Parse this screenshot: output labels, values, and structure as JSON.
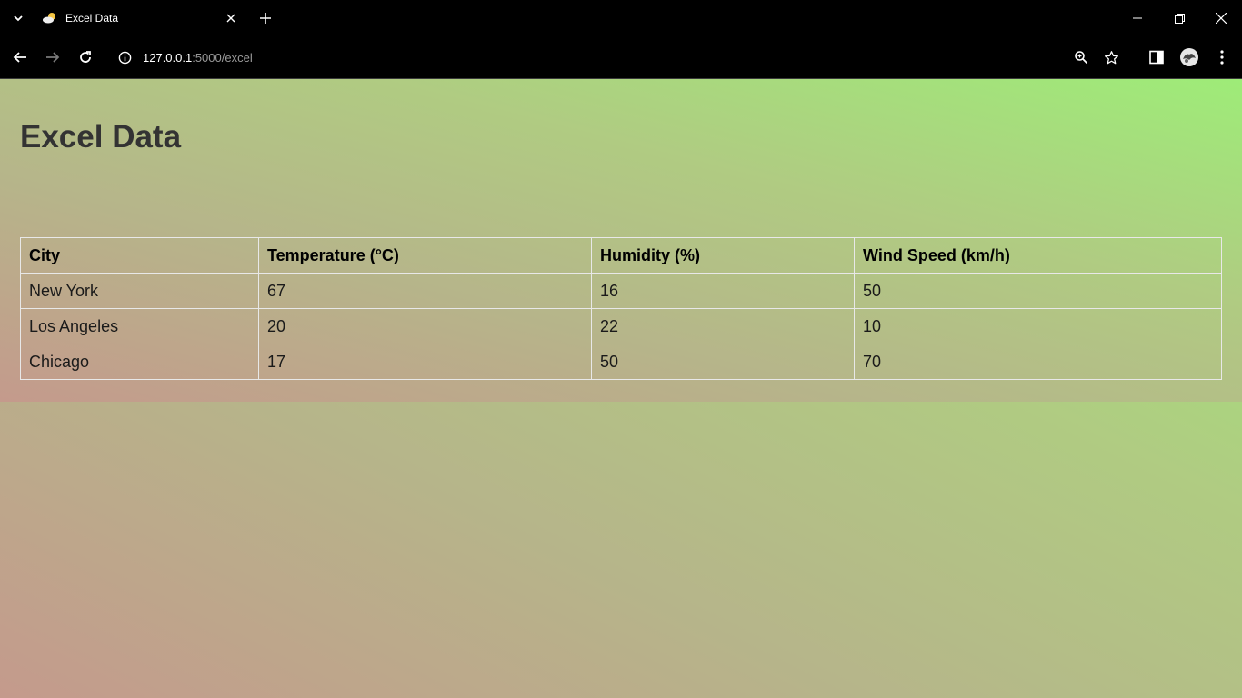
{
  "browser": {
    "tab_title": "Excel Data",
    "url_host": "127.0.0.1",
    "url_rest": ":5000/excel"
  },
  "page": {
    "title": "Excel Data",
    "table": {
      "headers": [
        "City",
        "Temperature (°C)",
        "Humidity (%)",
        "Wind Speed (km/h)"
      ],
      "rows": [
        [
          "New York",
          "67",
          "16",
          "50"
        ],
        [
          "Los Angeles",
          "20",
          "22",
          "10"
        ],
        [
          "Chicago",
          "17",
          "50",
          "70"
        ]
      ]
    }
  },
  "colors": {
    "gradient_bottom_left": "#c49a8c",
    "gradient_top_right": "#9eec78",
    "title_text": "#333333",
    "table_border": "#e8e8e8"
  },
  "icons": {
    "tab_favicon": "weather-icon",
    "tab_dropdown": "chevron-down-icon",
    "tab_close": "close-icon",
    "new_tab": "plus-icon",
    "back": "back-arrow-icon",
    "forward": "forward-arrow-icon",
    "reload": "reload-icon",
    "site_info": "info-icon",
    "zoom": "zoom-icon",
    "bookmark": "star-icon",
    "side_panel": "side-panel-icon",
    "profile": "profile-avatar-icon",
    "menu": "kebab-menu-icon"
  }
}
